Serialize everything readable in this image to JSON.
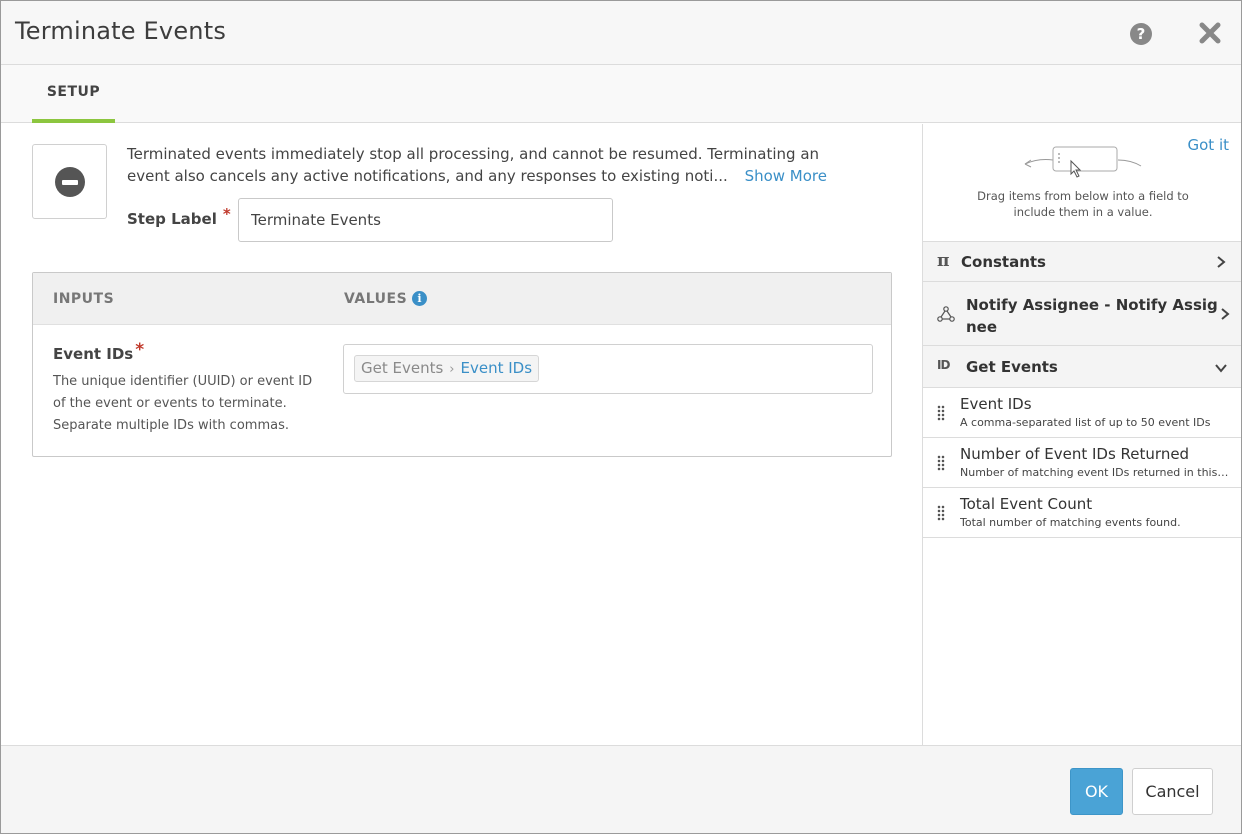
{
  "dialog": {
    "title": "Terminate Events"
  },
  "tabs": [
    {
      "label": "SETUP"
    }
  ],
  "step": {
    "description_line1": "Terminated events immediately stop all processing, and cannot be resumed. Terminating an",
    "description_line2": "event also cancels any active notifications, and any responses to existing noti...",
    "show_more": "Show More",
    "label_caption": "Step Label",
    "required_mark": "*",
    "label_value": "Terminate Events"
  },
  "inputs_table": {
    "inputs_header": "INPUTS",
    "values_header": "VALUES",
    "info_glyph": "i",
    "rows": [
      {
        "name": "Event IDs",
        "required_mark": "*",
        "help_line1": "The unique identifier (UUID) or event ID",
        "help_line2": "of the event or events to terminate.",
        "help_line3": "Separate multiple IDs with commas.",
        "value_chip": {
          "source": "Get Events",
          "separator": "›",
          "field": "Event IDs"
        }
      }
    ]
  },
  "side_panel": {
    "got_it": "Got it",
    "hint_line1": "Drag items from below into a field to",
    "hint_line2": "include them in a value.",
    "groups": [
      {
        "label": "Constants",
        "icon": "pi-icon",
        "glyph": "π",
        "expanded": false
      },
      {
        "label_line1": "Notify Assignee - Notify Assig",
        "label_line2": "nee",
        "icon": "flow-nodes-icon",
        "expanded": false
      },
      {
        "label": "Get Events",
        "icon": "id-search-icon",
        "glyph": "ID",
        "expanded": true
      }
    ],
    "items": [
      {
        "title": "Event IDs",
        "subtitle": "A comma-separated list of up to 50 event IDs"
      },
      {
        "title": "Number of Event IDs Returned",
        "subtitle": "Number of matching event IDs returned in this page"
      },
      {
        "title": "Total Event Count",
        "subtitle": "Total number of matching events found."
      }
    ]
  },
  "footer": {
    "ok_label": "OK",
    "cancel_label": "Cancel"
  },
  "colors": {
    "accent_blue": "#3a8fc7",
    "ok_button": "#4aa3d6",
    "tab_underline": "#8cc63f",
    "required": "#c0392b"
  }
}
